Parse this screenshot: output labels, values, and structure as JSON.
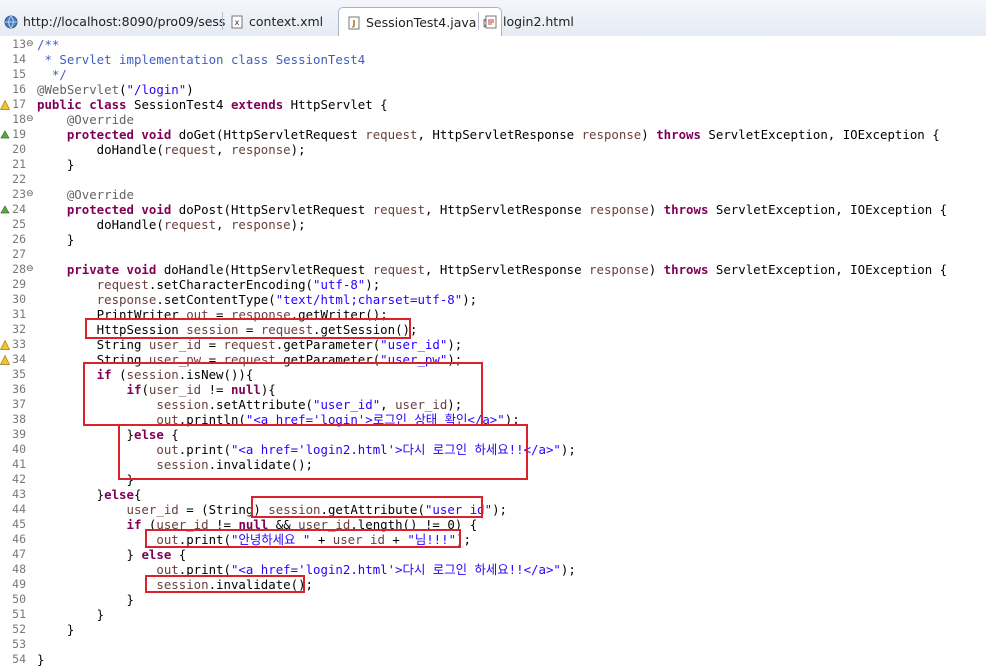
{
  "tabs": [
    {
      "label": "http://localhost:8090/pro09/sess",
      "icon": "globe-icon"
    },
    {
      "label": "context.xml",
      "icon": "xml-file-icon"
    },
    {
      "label": "SessionTest4.java",
      "icon": "java-file-icon",
      "active": true
    },
    {
      "label": "login2.html",
      "icon": "html-file-icon"
    }
  ],
  "close_glyph": "⊠",
  "code_lines": [
    {
      "n": "13",
      "marker": "⊖",
      "parts": [
        [
          "cm",
          "/**"
        ]
      ]
    },
    {
      "n": "14",
      "parts": [
        [
          "cm",
          " * Servlet implementation class SessionTest4"
        ]
      ]
    },
    {
      "n": "15",
      "parts": [
        [
          "cm",
          "  */"
        ]
      ]
    },
    {
      "n": "16",
      "parts": [
        [
          "an",
          "@WebServlet"
        ],
        [
          "",
          "("
        ],
        [
          "st",
          "\"/login\""
        ],
        [
          "",
          ")"
        ]
      ]
    },
    {
      "n": "17",
      "marker": "",
      "warn": true,
      "parts": [
        [
          "kw",
          "public class "
        ],
        [
          "",
          "SessionTest4 "
        ],
        [
          "kw",
          "extends "
        ],
        [
          "",
          "HttpServlet {"
        ]
      ]
    },
    {
      "n": "18",
      "marker": "⊖",
      "parts": [
        [
          "an",
          "    @Override"
        ]
      ]
    },
    {
      "n": "19",
      "warn2": true,
      "parts": [
        [
          "kw",
          "    protected void "
        ],
        [
          "",
          "doGet(HttpServletRequest "
        ],
        [
          "pm",
          "request"
        ],
        [
          "",
          ", HttpServletResponse "
        ],
        [
          "pm",
          "response"
        ],
        [
          "",
          ") "
        ],
        [
          "kw",
          "throws "
        ],
        [
          "",
          "ServletException, IOException {"
        ]
      ]
    },
    {
      "n": "20",
      "parts": [
        [
          "",
          "        doHandle("
        ],
        [
          "pm",
          "request"
        ],
        [
          "",
          ", "
        ],
        [
          "pm",
          "response"
        ],
        [
          "",
          ");"
        ]
      ]
    },
    {
      "n": "21",
      "parts": [
        [
          "",
          "    }"
        ]
      ]
    },
    {
      "n": "22",
      "parts": [
        [
          "",
          ""
        ]
      ]
    },
    {
      "n": "23",
      "marker": "⊖",
      "parts": [
        [
          "an",
          "    @Override"
        ]
      ]
    },
    {
      "n": "24",
      "warn2": true,
      "parts": [
        [
          "kw",
          "    protected void "
        ],
        [
          "",
          "doPost(HttpServletRequest "
        ],
        [
          "pm",
          "request"
        ],
        [
          "",
          ", HttpServletResponse "
        ],
        [
          "pm",
          "response"
        ],
        [
          "",
          ") "
        ],
        [
          "kw",
          "throws "
        ],
        [
          "",
          "ServletException, IOException {"
        ]
      ]
    },
    {
      "n": "25",
      "parts": [
        [
          "",
          "        doHandle("
        ],
        [
          "pm",
          "request"
        ],
        [
          "",
          ", "
        ],
        [
          "pm",
          "response"
        ],
        [
          "",
          ");"
        ]
      ]
    },
    {
      "n": "26",
      "parts": [
        [
          "",
          "    }"
        ]
      ]
    },
    {
      "n": "27",
      "parts": [
        [
          "",
          ""
        ]
      ]
    },
    {
      "n": "28",
      "marker": "⊖",
      "parts": [
        [
          "kw",
          "    private void "
        ],
        [
          "",
          "doHandle(HttpServletRequest "
        ],
        [
          "pm",
          "request"
        ],
        [
          "",
          ", HttpServletResponse "
        ],
        [
          "pm",
          "response"
        ],
        [
          "",
          ") "
        ],
        [
          "kw",
          "throws "
        ],
        [
          "",
          "ServletException, IOException {"
        ]
      ]
    },
    {
      "n": "29",
      "parts": [
        [
          "pm",
          "        request"
        ],
        [
          "",
          ".setCharacterEncoding("
        ],
        [
          "st",
          "\"utf-8\""
        ],
        [
          "",
          ");"
        ]
      ]
    },
    {
      "n": "30",
      "parts": [
        [
          "pm",
          "        response"
        ],
        [
          "",
          ".setContentType("
        ],
        [
          "st",
          "\"text/html;charset=utf-8\""
        ],
        [
          "",
          ");"
        ]
      ]
    },
    {
      "n": "31",
      "parts": [
        [
          "",
          "        PrintWriter "
        ],
        [
          "pm",
          "out"
        ],
        [
          "",
          " = "
        ],
        [
          "pm",
          "response"
        ],
        [
          "",
          ".getWriter();"
        ]
      ]
    },
    {
      "n": "32",
      "parts": [
        [
          "",
          "        HttpSession "
        ],
        [
          "pm",
          "session"
        ],
        [
          "",
          " = "
        ],
        [
          "pm",
          "request"
        ],
        [
          "",
          ".getSession();"
        ]
      ]
    },
    {
      "n": "33",
      "warn": true,
      "parts": [
        [
          "",
          "        String "
        ],
        [
          "pm",
          "user_id"
        ],
        [
          "",
          " = "
        ],
        [
          "pm",
          "request"
        ],
        [
          "",
          ".getParameter("
        ],
        [
          "st",
          "\"user_id\""
        ],
        [
          "",
          ");"
        ]
      ]
    },
    {
      "n": "34",
      "warn": true,
      "parts": [
        [
          "",
          "        String "
        ],
        [
          "pm",
          "user_pw"
        ],
        [
          "",
          " = "
        ],
        [
          "pm",
          "request"
        ],
        [
          "",
          ".getParameter("
        ],
        [
          "st",
          "\"user_pw\""
        ],
        [
          "",
          ");"
        ]
      ]
    },
    {
      "n": "35",
      "parts": [
        [
          "kw",
          "        if "
        ],
        [
          "",
          "("
        ],
        [
          "pm",
          "session"
        ],
        [
          "",
          ".isNew()){"
        ]
      ]
    },
    {
      "n": "36",
      "parts": [
        [
          "kw",
          "            if"
        ],
        [
          "",
          "("
        ],
        [
          "pm",
          "user_id"
        ],
        [
          "",
          " != "
        ],
        [
          "kw",
          "null"
        ],
        [
          "",
          "){"
        ]
      ]
    },
    {
      "n": "37",
      "parts": [
        [
          "pm",
          "                session"
        ],
        [
          "",
          ".setAttribute("
        ],
        [
          "st",
          "\"user_id\""
        ],
        [
          "",
          ", "
        ],
        [
          "pm",
          "user_id"
        ],
        [
          "",
          ");"
        ]
      ]
    },
    {
      "n": "38",
      "parts": [
        [
          "pm",
          "                out"
        ],
        [
          "",
          ".println("
        ],
        [
          "st",
          "\"<a href='login'>로그인 상태 확인</a>\""
        ],
        [
          "",
          ");"
        ]
      ]
    },
    {
      "n": "39",
      "parts": [
        [
          "",
          "            }"
        ],
        [
          "kw",
          "else "
        ],
        [
          "",
          "{"
        ]
      ]
    },
    {
      "n": "40",
      "parts": [
        [
          "pm",
          "                out"
        ],
        [
          "",
          ".print("
        ],
        [
          "st",
          "\"<a href='login2.html'>다시 로그인 하세요!!</a>\""
        ],
        [
          "",
          ");"
        ]
      ]
    },
    {
      "n": "41",
      "parts": [
        [
          "pm",
          "                session"
        ],
        [
          "",
          ".invalidate();"
        ]
      ]
    },
    {
      "n": "42",
      "parts": [
        [
          "",
          "            }"
        ]
      ]
    },
    {
      "n": "43",
      "parts": [
        [
          "",
          "        }"
        ],
        [
          "kw",
          "else"
        ],
        [
          "",
          "{"
        ]
      ]
    },
    {
      "n": "44",
      "parts": [
        [
          "pm",
          "            user_id"
        ],
        [
          "",
          " = (String) "
        ],
        [
          "pm",
          "session"
        ],
        [
          "",
          ".getAttribute("
        ],
        [
          "st",
          "\"user_id\""
        ],
        [
          "",
          ");"
        ]
      ]
    },
    {
      "n": "45",
      "parts": [
        [
          "kw",
          "            if "
        ],
        [
          "",
          "("
        ],
        [
          "pm",
          "user_id"
        ],
        [
          "",
          " != "
        ],
        [
          "kw",
          "null"
        ],
        [
          "",
          " && "
        ],
        [
          "pm",
          "user_id"
        ],
        [
          "",
          ".length() != 0) {"
        ]
      ]
    },
    {
      "n": "46",
      "parts": [
        [
          "pm",
          "                out"
        ],
        [
          "",
          ".print("
        ],
        [
          "st",
          "\"안녕하세요 \""
        ],
        [
          "",
          " + "
        ],
        [
          "pm",
          "user_id"
        ],
        [
          "",
          " + "
        ],
        [
          "st",
          "\"님!!!\""
        ],
        [
          "",
          ");"
        ]
      ]
    },
    {
      "n": "47",
      "parts": [
        [
          "",
          "            } "
        ],
        [
          "kw",
          "else "
        ],
        [
          "",
          "{"
        ]
      ]
    },
    {
      "n": "48",
      "parts": [
        [
          "pm",
          "                out"
        ],
        [
          "",
          ".print("
        ],
        [
          "st",
          "\"<a href='login2.html'>다시 로그인 하세요!!</a>\""
        ],
        [
          "",
          ");"
        ]
      ]
    },
    {
      "n": "49",
      "parts": [
        [
          "pm",
          "                session"
        ],
        [
          "",
          ".invalidate();"
        ]
      ]
    },
    {
      "n": "50",
      "parts": [
        [
          "",
          "            }"
        ]
      ]
    },
    {
      "n": "51",
      "parts": [
        [
          "",
          "        }"
        ]
      ]
    },
    {
      "n": "52",
      "parts": [
        [
          "",
          "    }"
        ]
      ]
    },
    {
      "n": "53",
      "parts": [
        [
          "",
          ""
        ]
      ]
    },
    {
      "n": "54",
      "parts": [
        [
          "",
          "}"
        ]
      ]
    }
  ],
  "colors": {
    "highlight_box": "#d9232a",
    "keyword": "#7f0055",
    "comment": "#3f5fbf",
    "string": "#2a00ff",
    "annotation": "#646464"
  }
}
